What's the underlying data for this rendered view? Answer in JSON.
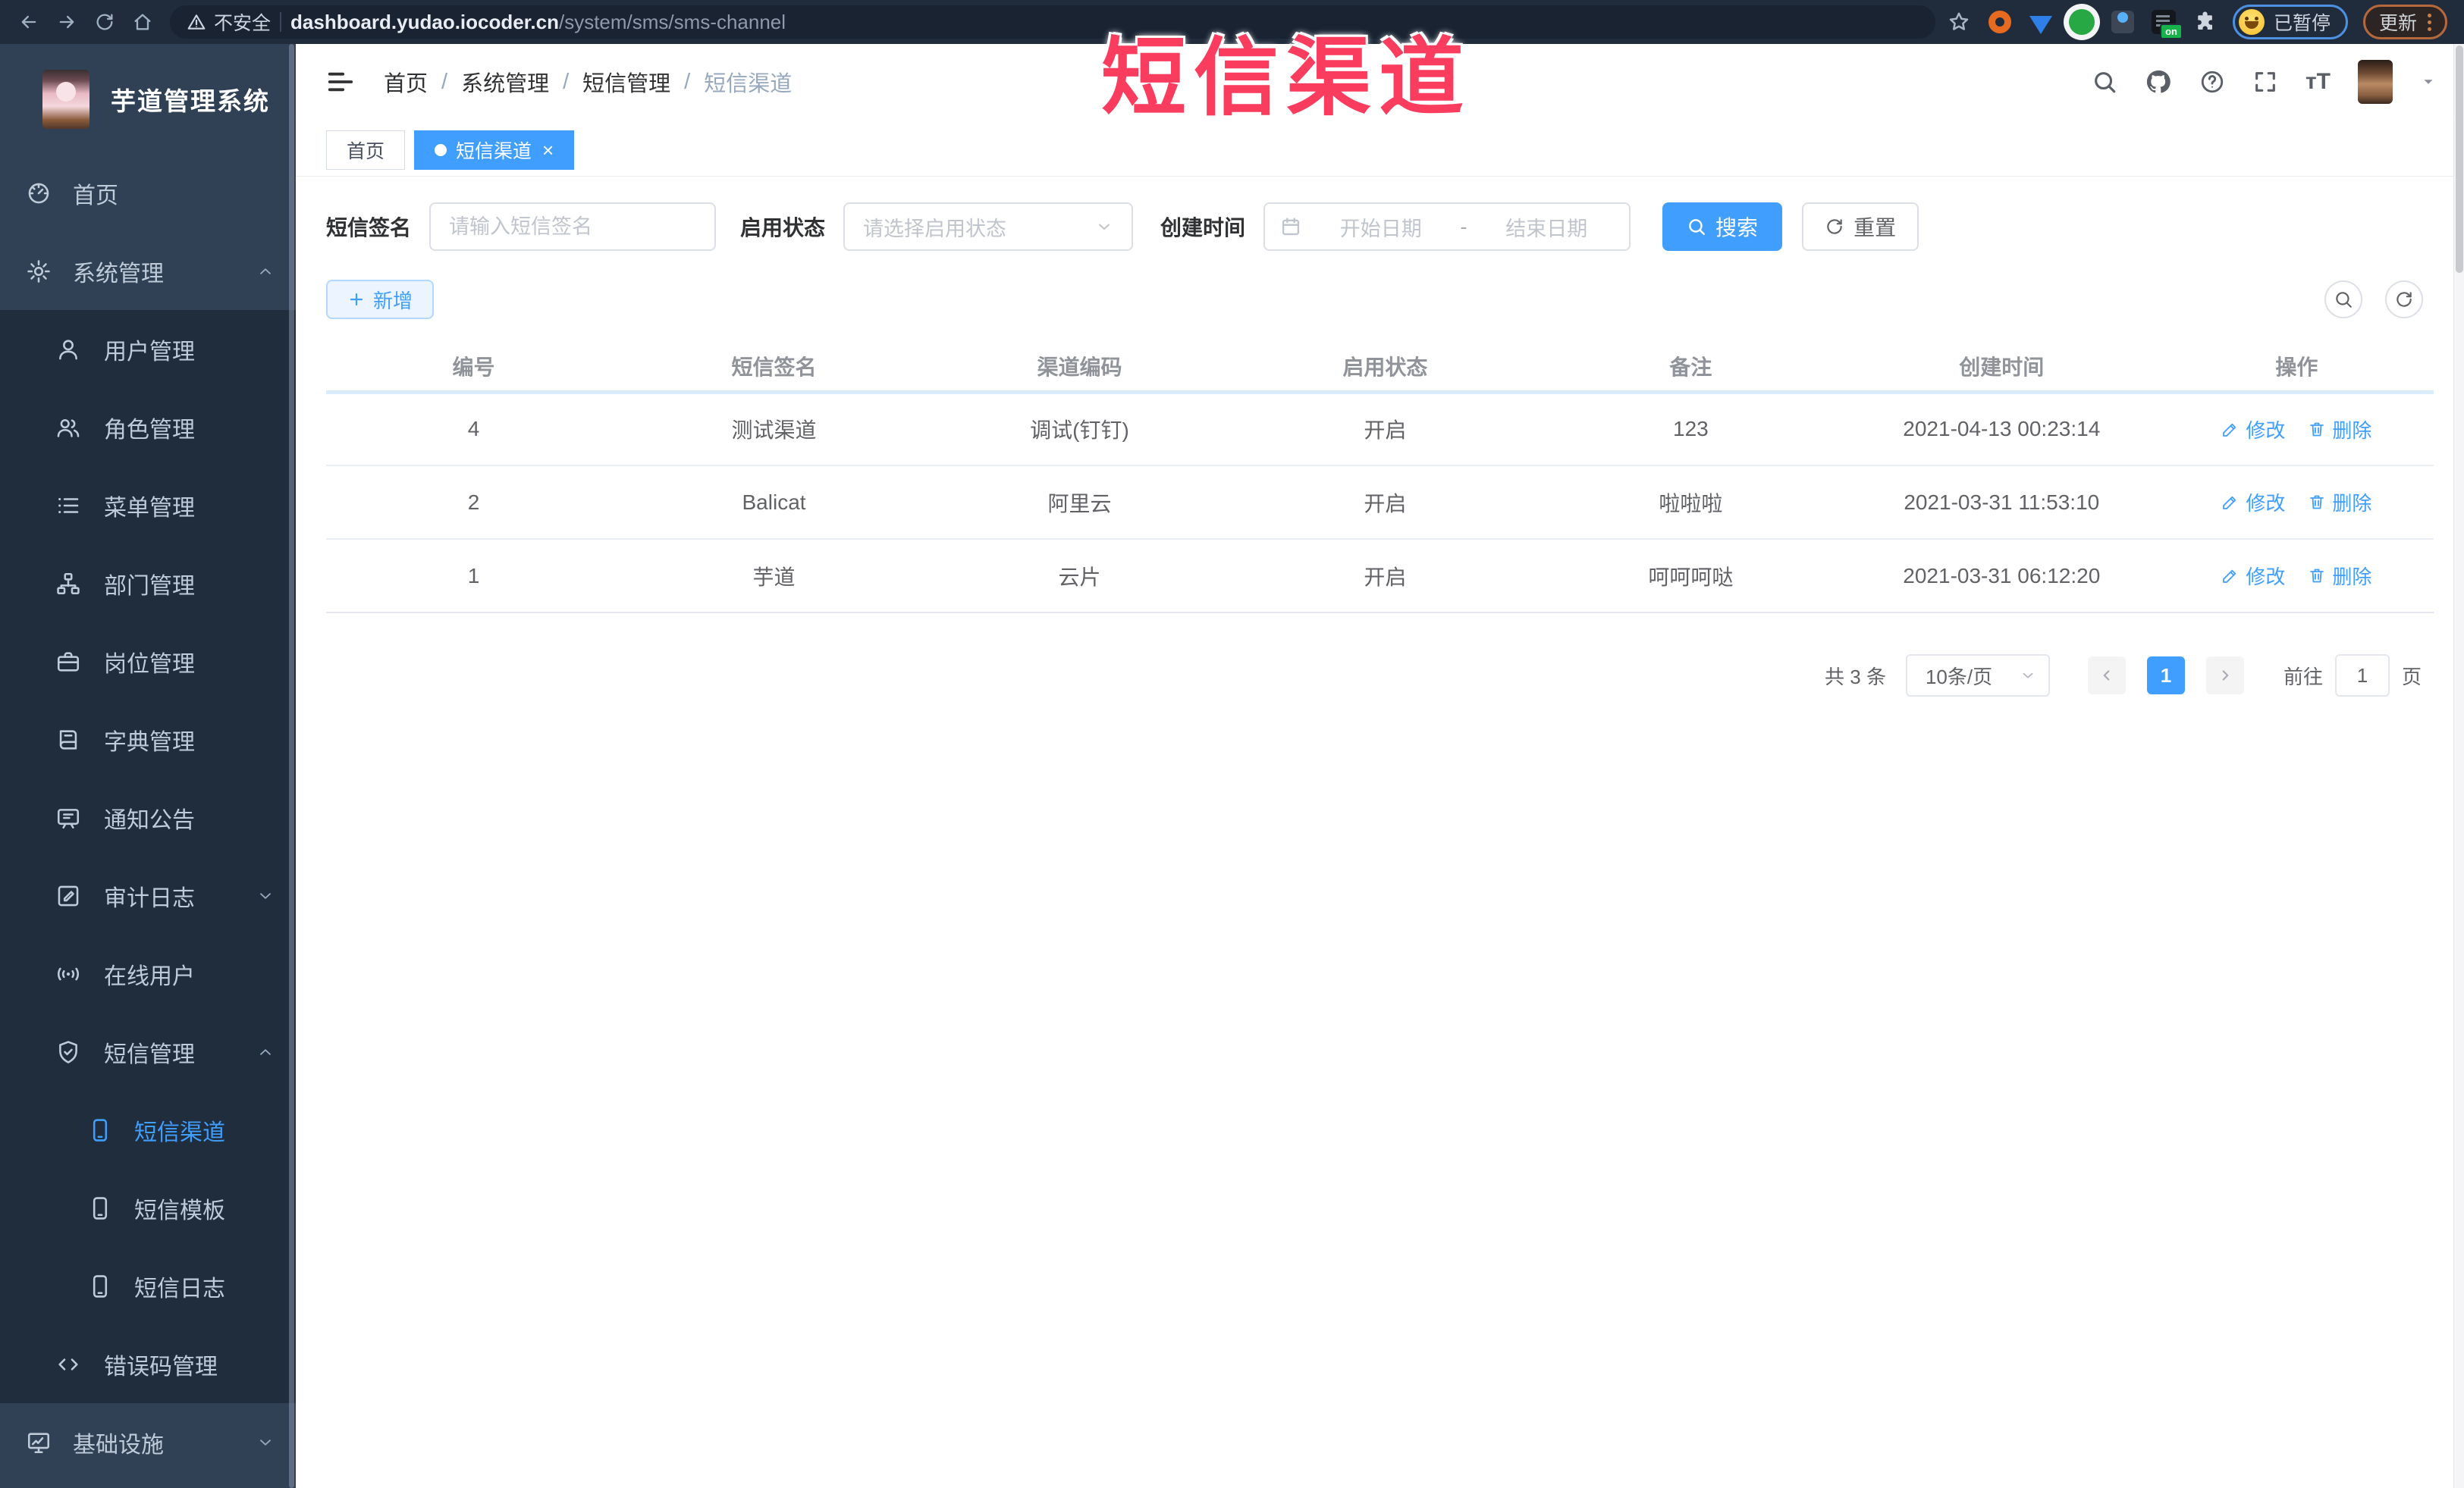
{
  "browser": {
    "security_label": "不安全",
    "url_host": "dashboard.yudao.iocoder.cn",
    "url_path": "/system/sms/sms-channel",
    "extension_badge": "on",
    "profile_label": "已暂停",
    "update_label": "更新"
  },
  "overlay": {
    "title": "短信渠道",
    "color": "#fa3c5f"
  },
  "sidebar": {
    "app_title": "芋道管理系统",
    "items": [
      {
        "label": "首页",
        "icon": "dashboard-icon",
        "level": 1
      },
      {
        "label": "系统管理",
        "icon": "gear-icon",
        "level": 1,
        "chevron": "up"
      },
      {
        "label": "用户管理",
        "icon": "user-icon",
        "level": 2
      },
      {
        "label": "角色管理",
        "icon": "users-icon",
        "level": 2
      },
      {
        "label": "菜单管理",
        "icon": "menu-list-icon",
        "level": 2
      },
      {
        "label": "部门管理",
        "icon": "org-tree-icon",
        "level": 2
      },
      {
        "label": "岗位管理",
        "icon": "briefcase-icon",
        "level": 2
      },
      {
        "label": "字典管理",
        "icon": "dictionary-icon",
        "level": 2
      },
      {
        "label": "通知公告",
        "icon": "announcement-icon",
        "level": 2
      },
      {
        "label": "审计日志",
        "icon": "audit-log-icon",
        "level": 2,
        "chevron": "down"
      },
      {
        "label": "在线用户",
        "icon": "online-users-icon",
        "level": 2
      },
      {
        "label": "短信管理",
        "icon": "sms-shield-icon",
        "level": 2,
        "chevron": "up"
      },
      {
        "label": "短信渠道",
        "icon": "phone-icon",
        "level": 3,
        "active": true
      },
      {
        "label": "短信模板",
        "icon": "phone-icon",
        "level": 3
      },
      {
        "label": "短信日志",
        "icon": "phone-icon",
        "level": 3
      },
      {
        "label": "错误码管理",
        "icon": "code-icon",
        "level": 2
      },
      {
        "label": "基础设施",
        "icon": "monitor-icon",
        "level": 1,
        "chevron": "down"
      }
    ]
  },
  "header": {
    "breadcrumb": [
      "首页",
      "系统管理",
      "短信管理",
      "短信渠道"
    ],
    "separator": "/"
  },
  "tabs": [
    {
      "label": "首页",
      "active": false
    },
    {
      "label": "短信渠道",
      "active": true,
      "close": "×"
    }
  ],
  "filters": {
    "sign_label": "短信签名",
    "sign_placeholder": "请输入短信签名",
    "status_label": "启用状态",
    "status_placeholder": "请选择启用状态",
    "time_label": "创建时间",
    "start_placeholder": "开始日期",
    "range_separator": "-",
    "end_placeholder": "结束日期",
    "search_label": "搜索",
    "reset_label": "重置"
  },
  "toolbar": {
    "add_label": "新增"
  },
  "table": {
    "columns": [
      "编号",
      "短信签名",
      "渠道编码",
      "启用状态",
      "备注",
      "创建时间",
      "操作"
    ],
    "rows": [
      {
        "id": "4",
        "sign": "测试渠道",
        "code": "调试(钉钉)",
        "status": "开启",
        "remark": "123",
        "created": "2021-04-13 00:23:14"
      },
      {
        "id": "2",
        "sign": "Balicat",
        "code": "阿里云",
        "status": "开启",
        "remark": "啦啦啦",
        "created": "2021-03-31 11:53:10"
      },
      {
        "id": "1",
        "sign": "芋道",
        "code": "云片",
        "status": "开启",
        "remark": "呵呵呵哒",
        "created": "2021-03-31 06:12:20"
      }
    ],
    "edit_label": "修改",
    "delete_label": "删除"
  },
  "pagination": {
    "total_text": "共 3 条",
    "page_size": "10条/页",
    "current_page": "1",
    "goto_label": "前往",
    "goto_value": "1",
    "unit_label": "页"
  },
  "colors": {
    "accent": "#409eff",
    "sidebar_bg": "#304156",
    "submenu_bg": "#1f2d3d",
    "browser_bar_bg": "#202b3b",
    "overlay_red": "#fa3c5f"
  },
  "icons": [
    "back-icon",
    "forward-icon",
    "reload-icon",
    "home-icon",
    "warning-icon",
    "star-icon",
    "puzzle-icon",
    "search-icon",
    "github-icon",
    "help-icon",
    "fullscreen-icon",
    "font-size-icon",
    "chevron-down-icon",
    "hamburger-icon",
    "calendar-icon",
    "refresh-icon",
    "plus-icon",
    "edit-icon",
    "trash-icon"
  ]
}
